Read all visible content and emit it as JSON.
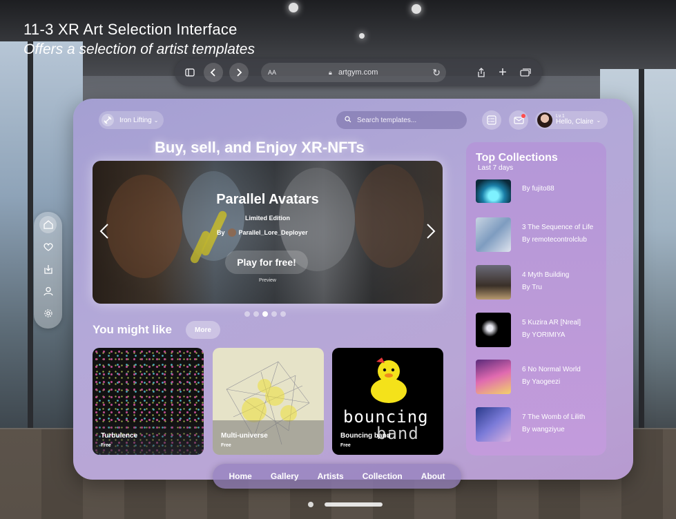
{
  "caption": {
    "title": "11-3 XR Art Selection Interface",
    "subtitle": "Offers a selection of artist templates"
  },
  "browser": {
    "text_size_label": "AA",
    "url": "artgym.com"
  },
  "header": {
    "workspace_label": "Iron Lifting",
    "search_placeholder": "Search templates...",
    "user_level": "Lv.1",
    "user_greeting": "Hello, Claire"
  },
  "headline": "Buy, sell, and Enjoy XR-NFTs",
  "hero": {
    "title": "Parallel Avatars",
    "edition": "Limited Edition",
    "by_label": "By",
    "author": "Parallel_Lore_Deployer",
    "cta": "Play for free!",
    "preview_label": "Preview",
    "slide_count": 5,
    "active_slide": 3
  },
  "recommendations": {
    "title": "You might like",
    "more_label": "More",
    "cards": [
      {
        "name": "Turbulence",
        "price": "Free"
      },
      {
        "name": "Multi-universe",
        "price": "Free"
      },
      {
        "name": "Bouncing band",
        "price": "Free",
        "art_text_1": "bouncing",
        "art_text_2": "band"
      }
    ]
  },
  "top_collections": {
    "title": "Top Collections",
    "subtitle": "Last 7 days",
    "items": [
      {
        "title": "",
        "by": "By fujito88"
      },
      {
        "title": "3 The Sequence of Life",
        "by": "By remotecontrolclub"
      },
      {
        "title": "4 Myth Building",
        "by": "By Tru"
      },
      {
        "title": "5 Kuzira AR [Nreal]",
        "by": "By YORIMIYA"
      },
      {
        "title": "6 No Normal World",
        "by": "By Yaogeezi"
      },
      {
        "title": "7 The Womb of Lilith",
        "by": "By wangziyue"
      }
    ]
  },
  "bottom_nav": [
    "Home",
    "Gallery",
    "Artists",
    "Collection",
    "About"
  ],
  "side_rail": [
    "home-icon",
    "heart-icon",
    "download-icon",
    "user-icon",
    "gear-icon"
  ],
  "colors": {
    "panel": "#b3a8d8",
    "accent_dot": "#ff4d4d",
    "duck_yellow": "#f4e21a"
  }
}
